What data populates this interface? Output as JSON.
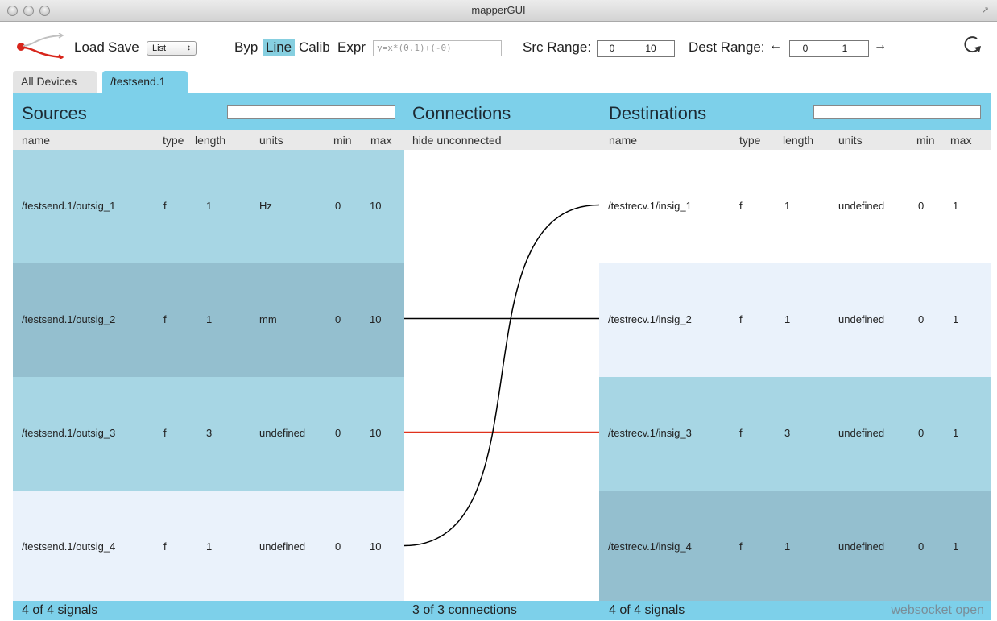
{
  "window": {
    "title": "mapperGUI"
  },
  "toolbar": {
    "load_label": "Load",
    "save_label": "Save",
    "view_select": "List",
    "byp_label": "Byp",
    "line_label": "Line",
    "calib_label": "Calib",
    "expr_label": "Expr",
    "expr_placeholder": "y=x*(0.1)+(-0)",
    "src_range_label": "Src Range:",
    "src_min": "0",
    "src_max": "10",
    "dest_range_label": "Dest Range:",
    "dest_min": "0",
    "dest_max": "1"
  },
  "tabs": [
    {
      "label": "All Devices"
    },
    {
      "label": "/testsend.1"
    }
  ],
  "sources": {
    "title": "Sources",
    "columns": [
      "name",
      "type",
      "length",
      "units",
      "min",
      "max"
    ],
    "rows": [
      {
        "name": "/testsend.1/outsig_1",
        "type": "f",
        "length": "1",
        "units": "Hz",
        "min": "0",
        "max": "10"
      },
      {
        "name": "/testsend.1/outsig_2",
        "type": "f",
        "length": "1",
        "units": "mm",
        "min": "0",
        "max": "10"
      },
      {
        "name": "/testsend.1/outsig_3",
        "type": "f",
        "length": "3",
        "units": "undefined",
        "min": "0",
        "max": "10"
      },
      {
        "name": "/testsend.1/outsig_4",
        "type": "f",
        "length": "1",
        "units": "undefined",
        "min": "0",
        "max": "10"
      }
    ],
    "footer": "4 of 4 signals"
  },
  "connections": {
    "title": "Connections",
    "subheader": "hide unconnected",
    "footer": "3 of 3 connections",
    "links": [
      {
        "from": 1,
        "to": 1,
        "color": "#000000"
      },
      {
        "from": 2,
        "to": 2,
        "color": "#e0321c"
      },
      {
        "from": 3,
        "to": 0,
        "color": "#000000"
      }
    ]
  },
  "destinations": {
    "title": "Destinations",
    "columns": [
      "name",
      "type",
      "length",
      "units",
      "min",
      "max"
    ],
    "rows": [
      {
        "name": "/testrecv.1/insig_1",
        "type": "f",
        "length": "1",
        "units": "undefined",
        "min": "0",
        "max": "1"
      },
      {
        "name": "/testrecv.1/insig_2",
        "type": "f",
        "length": "1",
        "units": "undefined",
        "min": "0",
        "max": "1"
      },
      {
        "name": "/testrecv.1/insig_3",
        "type": "f",
        "length": "3",
        "units": "undefined",
        "min": "0",
        "max": "1"
      },
      {
        "name": "/testrecv.1/insig_4",
        "type": "f",
        "length": "1",
        "units": "undefined",
        "min": "0",
        "max": "1"
      }
    ],
    "footer": "4 of 4 signals"
  },
  "status": "websocket open",
  "colors": {
    "accent": "#7dd0ea",
    "row_light": "#eaf2fb",
    "row_mid": "#a7d6e4",
    "row_dark": "#94bfcf",
    "selected_button": "#86cfe0"
  }
}
